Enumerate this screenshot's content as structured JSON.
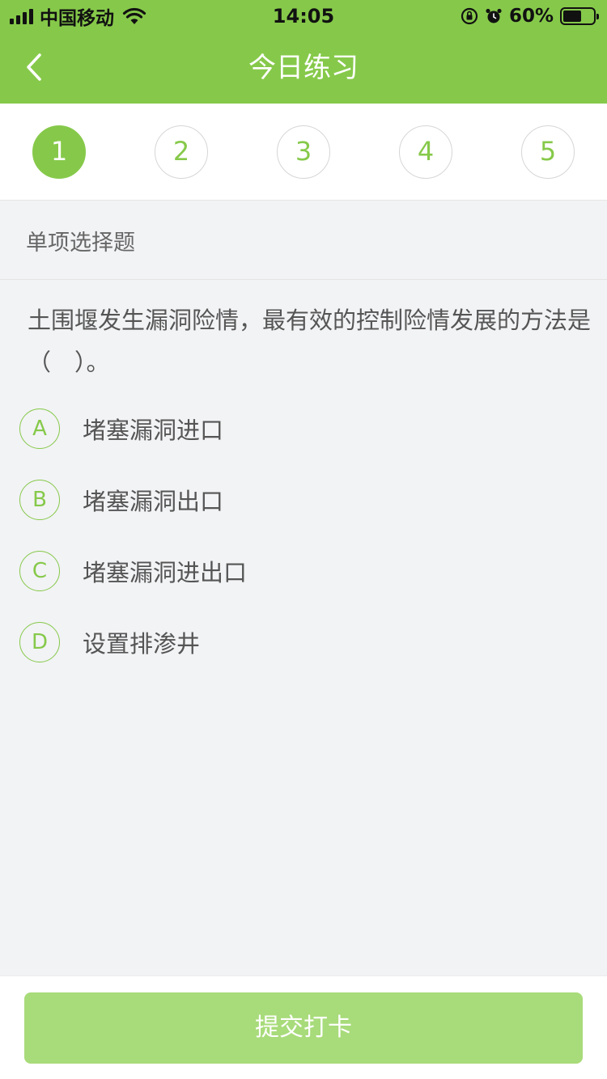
{
  "status_bar": {
    "carrier": "中国移动",
    "time": "14:05",
    "battery_percent": "60%",
    "battery_level": 0.6,
    "icons": [
      "signal-icon",
      "wifi-icon",
      "orientation-lock-icon",
      "alarm-icon",
      "battery-icon"
    ]
  },
  "navbar": {
    "title": "今日练习",
    "back_icon": "chevron-left-icon"
  },
  "steps": {
    "items": [
      "1",
      "2",
      "3",
      "4",
      "5"
    ],
    "active_index": 0
  },
  "question": {
    "type_label": "单项选择题",
    "text": "土围堰发生漏洞险情，最有效的控制险情发展的方法是（　）。",
    "options": [
      {
        "letter": "A",
        "text": "堵塞漏洞进口"
      },
      {
        "letter": "B",
        "text": "堵塞漏洞出口"
      },
      {
        "letter": "C",
        "text": "堵塞漏洞进出口"
      },
      {
        "letter": "D",
        "text": "设置排渗井"
      }
    ]
  },
  "footer": {
    "submit_label": "提交打卡"
  },
  "colors": {
    "brand_green": "#86c94a",
    "submit_disabled": "#a8db7a",
    "background": "#f2f3f5"
  }
}
